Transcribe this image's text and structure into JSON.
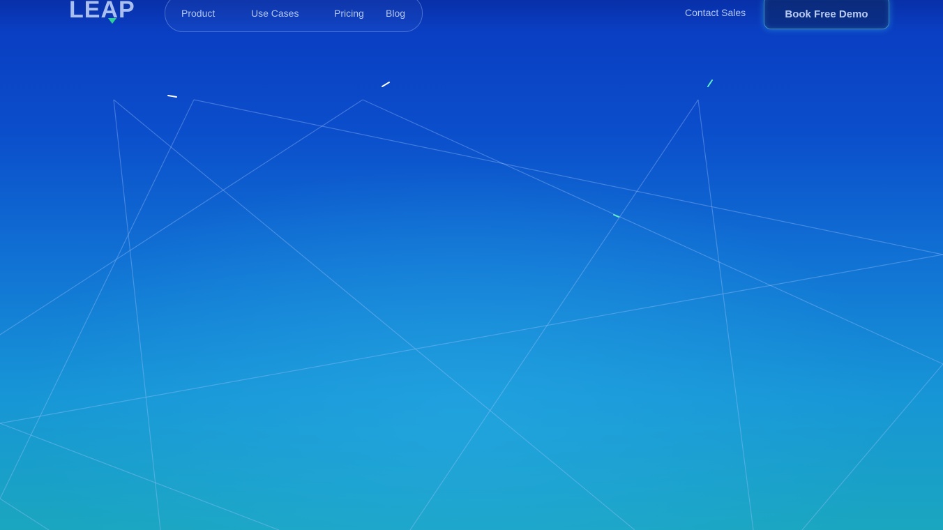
{
  "brand": {
    "logo_text": "LEAP"
  },
  "nav": {
    "links": [
      {
        "label": "Product"
      },
      {
        "label": "Use Cases"
      },
      {
        "label": "Pricing"
      },
      {
        "label": "Blog"
      }
    ],
    "contact_label": "Contact Sales",
    "cta_label": "Book Free Demo"
  },
  "colors": {
    "background_top": "#0a3ac0",
    "background_bottom": "#1aa6bf",
    "accent_green": "#2fd19a",
    "nav_text": "#b4c7ef"
  },
  "icons": {
    "logo_mark": "triangle-down-icon"
  }
}
